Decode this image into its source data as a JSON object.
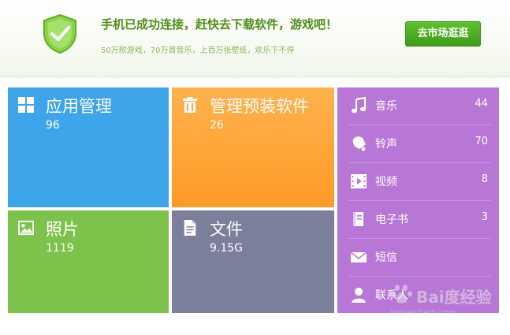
{
  "header": {
    "title": "手机已成功连接，赶快去下载软件，游戏吧！",
    "subtitle": "50万款游戏，70万首音乐，上百万张壁纸，欢乐下不停",
    "market_button": "去市场逛逛",
    "shield_icon": "shield-check-icon"
  },
  "tiles": [
    {
      "label": "应用管理",
      "count": "96",
      "icon": "grid-icon",
      "color": "#3ea5ea"
    },
    {
      "label": "管理预装软件",
      "count": "26",
      "icon": "trash-icon",
      "color": "#ff9f30"
    },
    {
      "label": "照片",
      "count": "1119",
      "icon": "picture-icon",
      "color": "#7dc24b"
    },
    {
      "label": "文件",
      "count": "9.15G",
      "icon": "file-icon",
      "color": "#7c7f9a"
    }
  ],
  "media": {
    "color": "#b876d6",
    "items": [
      {
        "label": "音乐",
        "count": "44",
        "icon": "music-note-icon"
      },
      {
        "label": "铃声",
        "count": "70",
        "icon": "bell-icon"
      },
      {
        "label": "视频",
        "count": "8",
        "icon": "film-icon"
      },
      {
        "label": "电子书",
        "count": "3",
        "icon": "book-icon"
      },
      {
        "label": "短信",
        "count": "",
        "icon": "envelope-icon"
      },
      {
        "label": "联系人",
        "count": "",
        "icon": "person-icon"
      }
    ]
  },
  "watermark": {
    "text": "Bai度经验",
    "url": "jingyan.baidu.com"
  }
}
